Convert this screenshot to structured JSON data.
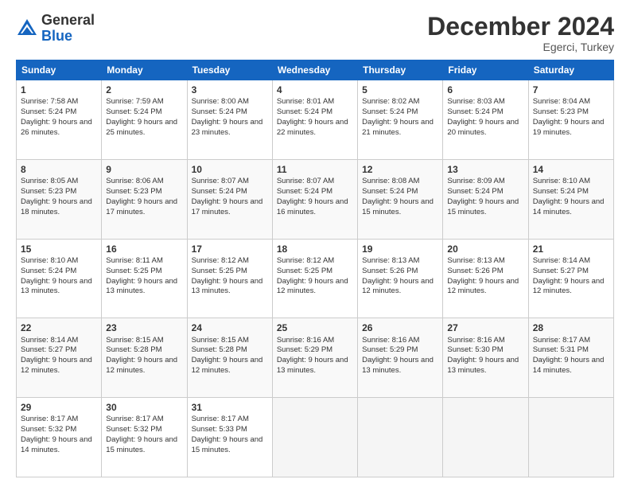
{
  "logo": {
    "general": "General",
    "blue": "Blue"
  },
  "header": {
    "month": "December 2024",
    "location": "Egerci, Turkey"
  },
  "weekdays": [
    "Sunday",
    "Monday",
    "Tuesday",
    "Wednesday",
    "Thursday",
    "Friday",
    "Saturday"
  ],
  "weeks": [
    [
      {
        "day": "1",
        "sunrise": "7:58 AM",
        "sunset": "5:24 PM",
        "daylight_hours": "9",
        "daylight_minutes": "26"
      },
      {
        "day": "2",
        "sunrise": "7:59 AM",
        "sunset": "5:24 PM",
        "daylight_hours": "9",
        "daylight_minutes": "25"
      },
      {
        "day": "3",
        "sunrise": "8:00 AM",
        "sunset": "5:24 PM",
        "daylight_hours": "9",
        "daylight_minutes": "23"
      },
      {
        "day": "4",
        "sunrise": "8:01 AM",
        "sunset": "5:24 PM",
        "daylight_hours": "9",
        "daylight_minutes": "22"
      },
      {
        "day": "5",
        "sunrise": "8:02 AM",
        "sunset": "5:24 PM",
        "daylight_hours": "9",
        "daylight_minutes": "21"
      },
      {
        "day": "6",
        "sunrise": "8:03 AM",
        "sunset": "5:24 PM",
        "daylight_hours": "9",
        "daylight_minutes": "20"
      },
      {
        "day": "7",
        "sunrise": "8:04 AM",
        "sunset": "5:23 PM",
        "daylight_hours": "9",
        "daylight_minutes": "19"
      }
    ],
    [
      {
        "day": "8",
        "sunrise": "8:05 AM",
        "sunset": "5:23 PM",
        "daylight_hours": "9",
        "daylight_minutes": "18"
      },
      {
        "day": "9",
        "sunrise": "8:06 AM",
        "sunset": "5:23 PM",
        "daylight_hours": "9",
        "daylight_minutes": "17"
      },
      {
        "day": "10",
        "sunrise": "8:07 AM",
        "sunset": "5:24 PM",
        "daylight_hours": "9",
        "daylight_minutes": "17"
      },
      {
        "day": "11",
        "sunrise": "8:07 AM",
        "sunset": "5:24 PM",
        "daylight_hours": "9",
        "daylight_minutes": "16"
      },
      {
        "day": "12",
        "sunrise": "8:08 AM",
        "sunset": "5:24 PM",
        "daylight_hours": "9",
        "daylight_minutes": "15"
      },
      {
        "day": "13",
        "sunrise": "8:09 AM",
        "sunset": "5:24 PM",
        "daylight_hours": "9",
        "daylight_minutes": "15"
      },
      {
        "day": "14",
        "sunrise": "8:10 AM",
        "sunset": "5:24 PM",
        "daylight_hours": "9",
        "daylight_minutes": "14"
      }
    ],
    [
      {
        "day": "15",
        "sunrise": "8:10 AM",
        "sunset": "5:24 PM",
        "daylight_hours": "9",
        "daylight_minutes": "13"
      },
      {
        "day": "16",
        "sunrise": "8:11 AM",
        "sunset": "5:25 PM",
        "daylight_hours": "9",
        "daylight_minutes": "13"
      },
      {
        "day": "17",
        "sunrise": "8:12 AM",
        "sunset": "5:25 PM",
        "daylight_hours": "9",
        "daylight_minutes": "13"
      },
      {
        "day": "18",
        "sunrise": "8:12 AM",
        "sunset": "5:25 PM",
        "daylight_hours": "9",
        "daylight_minutes": "12"
      },
      {
        "day": "19",
        "sunrise": "8:13 AM",
        "sunset": "5:26 PM",
        "daylight_hours": "9",
        "daylight_minutes": "12"
      },
      {
        "day": "20",
        "sunrise": "8:13 AM",
        "sunset": "5:26 PM",
        "daylight_hours": "9",
        "daylight_minutes": "12"
      },
      {
        "day": "21",
        "sunrise": "8:14 AM",
        "sunset": "5:27 PM",
        "daylight_hours": "9",
        "daylight_minutes": "12"
      }
    ],
    [
      {
        "day": "22",
        "sunrise": "8:14 AM",
        "sunset": "5:27 PM",
        "daylight_hours": "9",
        "daylight_minutes": "12"
      },
      {
        "day": "23",
        "sunrise": "8:15 AM",
        "sunset": "5:28 PM",
        "daylight_hours": "9",
        "daylight_minutes": "12"
      },
      {
        "day": "24",
        "sunrise": "8:15 AM",
        "sunset": "5:28 PM",
        "daylight_hours": "9",
        "daylight_minutes": "12"
      },
      {
        "day": "25",
        "sunrise": "8:16 AM",
        "sunset": "5:29 PM",
        "daylight_hours": "9",
        "daylight_minutes": "13"
      },
      {
        "day": "26",
        "sunrise": "8:16 AM",
        "sunset": "5:29 PM",
        "daylight_hours": "9",
        "daylight_minutes": "13"
      },
      {
        "day": "27",
        "sunrise": "8:16 AM",
        "sunset": "5:30 PM",
        "daylight_hours": "9",
        "daylight_minutes": "13"
      },
      {
        "day": "28",
        "sunrise": "8:17 AM",
        "sunset": "5:31 PM",
        "daylight_hours": "9",
        "daylight_minutes": "14"
      }
    ],
    [
      {
        "day": "29",
        "sunrise": "8:17 AM",
        "sunset": "5:32 PM",
        "daylight_hours": "9",
        "daylight_minutes": "14"
      },
      {
        "day": "30",
        "sunrise": "8:17 AM",
        "sunset": "5:32 PM",
        "daylight_hours": "9",
        "daylight_minutes": "15"
      },
      {
        "day": "31",
        "sunrise": "8:17 AM",
        "sunset": "5:33 PM",
        "daylight_hours": "9",
        "daylight_minutes": "15"
      },
      null,
      null,
      null,
      null
    ]
  ],
  "labels": {
    "sunrise": "Sunrise:",
    "sunset": "Sunset:",
    "daylight": "Daylight:",
    "hours_suffix": "hours",
    "and": "and",
    "minutes_suffix": "minutes."
  }
}
